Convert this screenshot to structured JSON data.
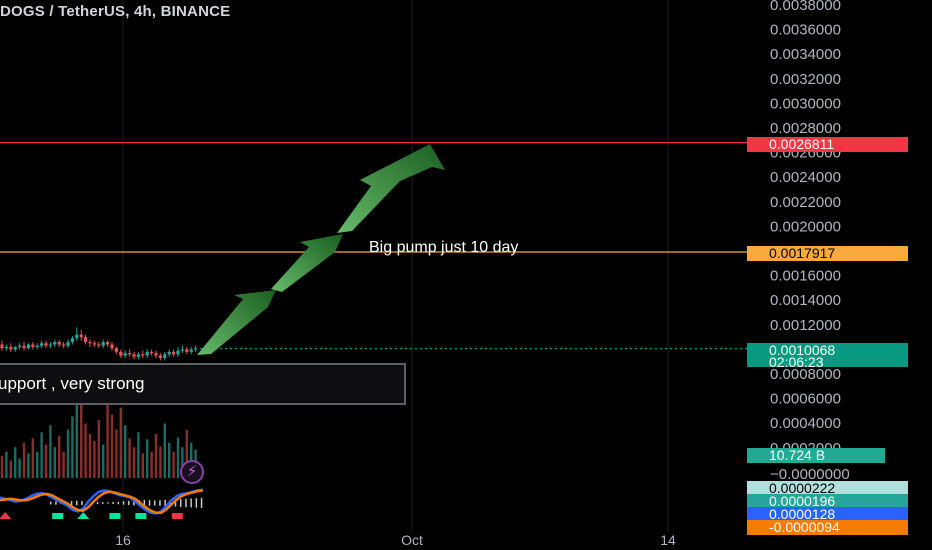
{
  "title": "DOGS / TetherUS, 4h, BINANCE",
  "annotations": {
    "support_text": "upport , very strong",
    "pump_text": "Big pump just 10 day"
  },
  "colors": {
    "up": "#26a69a",
    "down": "#ef5350",
    "resistance_line": "#f23645",
    "target_line": "#f7a93b",
    "arrow_light": "#66bb6a",
    "arrow_dark": "#1b5e20"
  },
  "price_badges": {
    "resistance": {
      "text": "0.0026811",
      "bg": "#f23645",
      "fg": "#ffffff"
    },
    "target": {
      "text": "0.0017917",
      "bg": "#f7a93b",
      "fg": "#000000"
    },
    "current_price": {
      "text": "0.0010068",
      "bg": "#089981",
      "fg": "#ffffff"
    },
    "countdown": {
      "text": "02:06:23",
      "bg": "#089981",
      "fg": "#ffffff"
    },
    "volume": {
      "text": "10.724 B",
      "bg": "#22ab94",
      "fg": "#ffffff"
    },
    "osc_1": {
      "text": "0.0000222",
      "bg": "#b2dfdb",
      "fg": "#000000"
    },
    "osc_2": {
      "text": "0.0000196",
      "bg": "#26a69a",
      "fg": "#ffffff"
    },
    "osc_3": {
      "text": "0.0000128",
      "bg": "#2962ff",
      "fg": "#ffffff"
    },
    "osc_4": {
      "text": "-0.0000094",
      "bg": "#f57c00",
      "fg": "#ffffff"
    }
  },
  "indicator_icon": "lightning-icon",
  "chart_data": {
    "type": "candlestick",
    "title": "DOGS / TetherUS, 4h, BINANCE",
    "y_axis": {
      "ticks": [
        "0.0038000",
        "0.0036000",
        "0.0034000",
        "0.0032000",
        "0.0030000",
        "0.0028000",
        "0.0026000",
        "0.0024000",
        "0.0022000",
        "0.0020000",
        "0.0018000",
        "0.0016000",
        "0.0014000",
        "0.0012000",
        "0.0010000",
        "0.0008000",
        "0.0006000",
        "0.0004000",
        "0.0002000"
      ],
      "range": [
        0.0001,
        0.0038
      ],
      "zero_label": "−0.0000000"
    },
    "x_axis": {
      "tick_labels": [
        "16",
        "Oct",
        "14"
      ]
    },
    "horizontal_lines": [
      {
        "price": 0.0026811,
        "color": "#f23645"
      },
      {
        "price": 0.0017917,
        "color": "#f7a93b"
      },
      {
        "price": 0.0010068,
        "color": "#089981",
        "style": "dotted"
      }
    ],
    "candles": {
      "open": [
        0.00104,
        0.00101,
        0.00102,
        0.001,
        0.00102,
        0.00103,
        0.00101,
        0.00104,
        0.00102,
        0.00103,
        0.00105,
        0.00103,
        0.00104,
        0.00106,
        0.00104,
        0.00103,
        0.00106,
        0.00109,
        0.00112,
        0.0011,
        0.00106,
        0.00105,
        0.00104,
        0.00103,
        0.00106,
        0.00104,
        0.00101,
        0.00098,
        0.00095,
        0.00097,
        0.00096,
        0.00094,
        0.00096,
        0.00095,
        0.00098,
        0.00097,
        0.00095,
        0.00093,
        0.00096,
        0.00098,
        0.00096,
        0.00099,
        0.001,
        0.00098,
        0.001
      ],
      "close": [
        0.00101,
        0.00102,
        0.001,
        0.00102,
        0.00103,
        0.00101,
        0.00104,
        0.00102,
        0.00103,
        0.00105,
        0.00103,
        0.00104,
        0.00106,
        0.00104,
        0.00103,
        0.00106,
        0.00109,
        0.00112,
        0.0011,
        0.00106,
        0.00105,
        0.00104,
        0.00103,
        0.00106,
        0.00104,
        0.00101,
        0.00098,
        0.00095,
        0.00097,
        0.00096,
        0.00094,
        0.00096,
        0.00095,
        0.00098,
        0.00097,
        0.00095,
        0.00093,
        0.00096,
        0.00098,
        0.00096,
        0.00099,
        0.001,
        0.00098,
        0.001,
        0.00101
      ],
      "high": [
        0.00107,
        0.00104,
        0.00105,
        0.00103,
        0.00105,
        0.00106,
        0.00105,
        0.00106,
        0.00105,
        0.00107,
        0.00107,
        0.00106,
        0.00108,
        0.00108,
        0.00106,
        0.00108,
        0.00111,
        0.00118,
        0.00116,
        0.00112,
        0.00108,
        0.00107,
        0.00106,
        0.00108,
        0.00107,
        0.00106,
        0.00102,
        0.001,
        0.00099,
        0.001,
        0.00098,
        0.00098,
        0.00099,
        0.001,
        0.001,
        0.00099,
        0.00097,
        0.00098,
        0.001,
        0.001,
        0.00102,
        0.00103,
        0.00102,
        0.00102,
        0.00103
      ],
      "low": [
        0.00099,
        0.00099,
        0.00098,
        0.00098,
        0.001,
        0.00099,
        0.001,
        0.001,
        0.001,
        0.00101,
        0.00101,
        0.00101,
        0.00102,
        0.00102,
        0.00101,
        0.00101,
        0.00104,
        0.00107,
        0.00107,
        0.00104,
        0.00102,
        0.00102,
        0.00101,
        0.00101,
        0.00102,
        0.00099,
        0.00096,
        0.00093,
        0.00093,
        0.00094,
        0.00092,
        0.00092,
        0.00093,
        0.00093,
        0.00095,
        0.00093,
        0.00091,
        0.00091,
        0.00094,
        0.00094,
        0.00094,
        0.00097,
        0.00096,
        0.00096,
        0.00098
      ]
    },
    "volume_heights": [
      0.25,
      0.3,
      0.2,
      0.35,
      0.22,
      0.4,
      0.28,
      0.45,
      0.3,
      0.52,
      0.38,
      0.6,
      0.35,
      0.48,
      0.3,
      0.55,
      0.7,
      1.0,
      0.85,
      0.62,
      0.5,
      0.42,
      0.66,
      0.38,
      0.9,
      0.72,
      0.55,
      0.8,
      0.6,
      0.45,
      0.35,
      0.52,
      0.28,
      0.44,
      0.3,
      0.5,
      0.36,
      0.62,
      0.4,
      0.3,
      0.46,
      0.35,
      0.55,
      0.4,
      0.32
    ],
    "oscillator": {
      "series": [
        {
          "color": "#2962ff",
          "values": [
            0.4,
            0.3,
            0.2,
            0.1,
            0.15,
            0.3,
            0.5,
            0.65,
            0.7,
            0.6,
            0.4,
            0.2,
            0.0,
            -0.2,
            -0.5,
            -0.6,
            -0.4,
            0.1,
            0.5,
            0.8,
            0.9,
            0.85,
            0.7,
            0.55,
            0.5,
            0.4,
            0.1,
            -0.2,
            -0.5,
            -0.7,
            -0.75,
            -0.6,
            -0.2,
            0.2,
            0.5,
            0.65,
            0.7,
            0.8,
            0.9,
            0.95
          ]
        },
        {
          "color": "#f57c00",
          "values": [
            0.2,
            0.25,
            0.3,
            0.25,
            0.2,
            0.2,
            0.3,
            0.45,
            0.6,
            0.65,
            0.55,
            0.35,
            0.15,
            -0.05,
            -0.3,
            -0.5,
            -0.55,
            -0.3,
            0.1,
            0.45,
            0.7,
            0.8,
            0.75,
            0.65,
            0.55,
            0.45,
            0.3,
            0.0,
            -0.3,
            -0.55,
            -0.7,
            -0.7,
            -0.45,
            -0.1,
            0.25,
            0.5,
            0.65,
            0.75,
            0.85,
            0.9
          ]
        }
      ],
      "histogram": [
        0.1,
        0.12,
        0.08,
        0.1,
        0.14,
        0.16,
        0.15,
        0.12,
        0.1,
        0.08,
        0.06,
        0.05,
        0.07,
        0.09,
        0.12,
        0.15,
        0.18,
        0.2,
        0.22,
        0.2,
        0.18,
        0.2,
        0.22,
        0.24,
        0.26,
        0.28,
        0.3,
        0.32,
        0.34,
        0.36
      ],
      "markers": [
        {
          "i": 1,
          "color": "#f23645",
          "shape": "up"
        },
        {
          "i": 11,
          "color": "#00e6a0",
          "shape": "square"
        },
        {
          "i": 16,
          "color": "#00e6a0",
          "shape": "up"
        },
        {
          "i": 22,
          "color": "#00e6a0",
          "shape": "square"
        },
        {
          "i": 27,
          "color": "#00e6a0",
          "shape": "square"
        },
        {
          "i": 34,
          "color": "#f23645",
          "shape": "square"
        }
      ]
    }
  }
}
